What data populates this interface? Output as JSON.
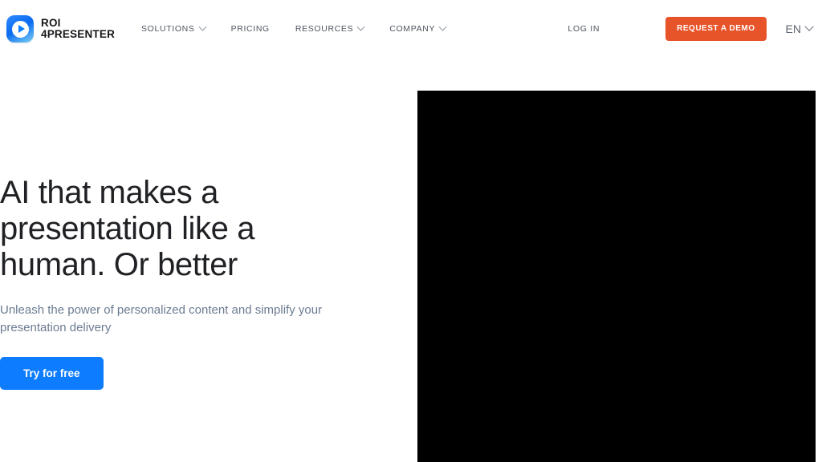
{
  "header": {
    "brand": {
      "logo_icon": "play-button-logo-icon",
      "line1": "ROI",
      "line2": "4PRESENTER"
    },
    "nav": [
      {
        "label": "SOLUTIONS",
        "has_dropdown": true,
        "icon": "chevron-down-icon"
      },
      {
        "label": "PRICING",
        "has_dropdown": false,
        "icon": ""
      },
      {
        "label": "RESOURCES",
        "has_dropdown": true,
        "icon": "chevron-down-icon"
      },
      {
        "label": "COMPANY",
        "has_dropdown": true,
        "icon": "chevron-down-icon"
      }
    ],
    "login_label": "LOG IN",
    "demo_label": "REQUEST A DEMO",
    "language": {
      "current": "EN",
      "icon": "chevron-down-icon"
    }
  },
  "hero": {
    "headline": "AI that makes a presentation like a human. Or better",
    "subhead": "Unleash the power of personalized content and simplify your presentation delivery",
    "cta_label": "Try for free",
    "media": {
      "type": "video",
      "state": "blank"
    }
  },
  "colors": {
    "accent_orange": "#e8542a",
    "accent_blue": "#0d7cff",
    "nav_text": "#4d5560",
    "headline": "#1f2124",
    "subhead": "#6b7b91",
    "page_background": "#ffffff",
    "media_background": "#000000"
  }
}
